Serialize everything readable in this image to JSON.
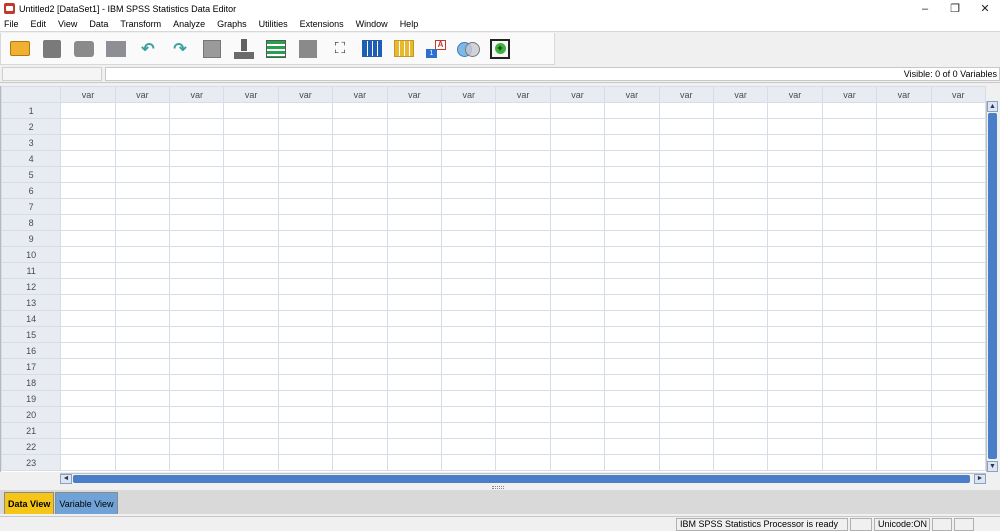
{
  "window": {
    "title": "Untitled2 [DataSet1] - IBM SPSS Statistics Data Editor",
    "minimize": "–",
    "restore": "❐",
    "close": "✕"
  },
  "menu": [
    "File",
    "Edit",
    "View",
    "Data",
    "Transform",
    "Analyze",
    "Graphs",
    "Utilities",
    "Extensions",
    "Window",
    "Help"
  ],
  "toolbar": {
    "icons": [
      "open-folder-icon",
      "save-icon",
      "print-icon",
      "dialog-recall-icon",
      "undo-icon",
      "redo-icon",
      "go-to-case-icon",
      "insert-cases-icon",
      "insert-variable-icon",
      "split-file-icon",
      "find-icon",
      "value-labels-icon",
      "use-variable-sets-icon",
      "show-all-variables-icon",
      "spelling-icon",
      "extension-icon"
    ],
    "undo_glyph": "↶",
    "redo_glyph": "↷",
    "find_glyph": "⛶",
    "value_a": "A",
    "value_n": "1",
    "ext_glyph": "+"
  },
  "cellbar": {
    "cell_ref": "",
    "cell_content": "",
    "visible": "Visible: 0 of 0 Variables"
  },
  "grid": {
    "column_header": "var",
    "column_count": 17,
    "rows": [
      "1",
      "2",
      "3",
      "4",
      "5",
      "6",
      "7",
      "8",
      "9",
      "10",
      "11",
      "12",
      "13",
      "14",
      "15",
      "16",
      "17",
      "18",
      "19",
      "20",
      "21",
      "22",
      "23"
    ]
  },
  "scroll": {
    "up": "▲",
    "down": "▼",
    "left": "◄",
    "right": "►"
  },
  "tabs": {
    "data_view": "Data View",
    "variable_view": "Variable View"
  },
  "status": {
    "processor": "IBM SPSS Statistics Processor is ready",
    "unicode": "Unicode:ON"
  },
  "colors": {
    "active_tab": "#f5c518",
    "inactive_tab": "#6fa3d8",
    "scroll_thumb": "#4a7ec8"
  }
}
